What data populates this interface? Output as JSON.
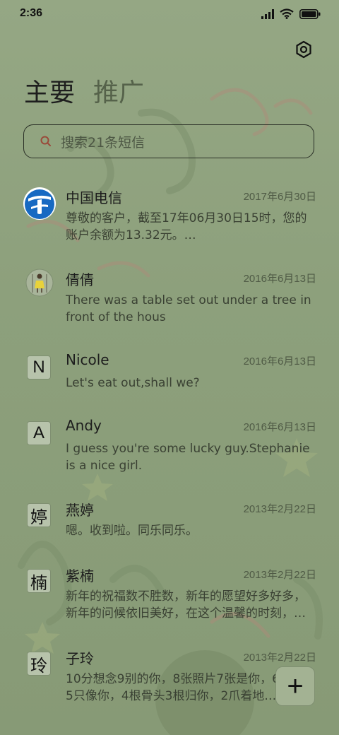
{
  "status_bar": {
    "time": "2:36"
  },
  "header": {
    "tabs": [
      {
        "label": "主要"
      },
      {
        "label": "推广"
      }
    ],
    "settings_icon": "gear-icon"
  },
  "search": {
    "placeholder": "搜索21条短信"
  },
  "conversations": [
    {
      "name": "中国电信",
      "date": "2017年6月30日",
      "preview": "尊敬的客户，截至17年06月30日15时，您的账户余额为13.32元。…",
      "avatar": "china-telecom-logo"
    },
    {
      "name": "倩倩",
      "date": "2016年6月13日",
      "preview": "There was a table set out under a tree in front of the hous",
      "avatar": "photo"
    },
    {
      "name": "Nicole",
      "date": "2016年6月13日",
      "preview": "Let's eat out,shall we?",
      "avatar_letter": "N"
    },
    {
      "name": "Andy",
      "date": "2016年6月13日",
      "preview": "I guess you're some lucky guy.Stephanie is a nice girl.",
      "avatar_letter": "A"
    },
    {
      "name": "燕婷",
      "date": "2013年2月22日",
      "preview": "嗯。收到啦。同乐同乐。",
      "avatar_letter": "婷"
    },
    {
      "name": "紫楠",
      "date": "2013年2月22日",
      "preview": "新年的祝福数不胜数，新年的愿望好多好多，新年的问候依旧美好，在这个温馨的时刻，…",
      "avatar_letter": "楠"
    },
    {
      "name": "子玲",
      "date": "2013年2月22日",
      "preview": "10分想念9别的你，8张照片7张是你，6条小狗5只像你，4根骨头3根归你，2爪着地…",
      "avatar_letter": "玲"
    }
  ],
  "fab": {
    "label": "+"
  },
  "colors": {
    "background": "#8fa27e",
    "text": "#222222",
    "muted": "#4f5a45"
  }
}
